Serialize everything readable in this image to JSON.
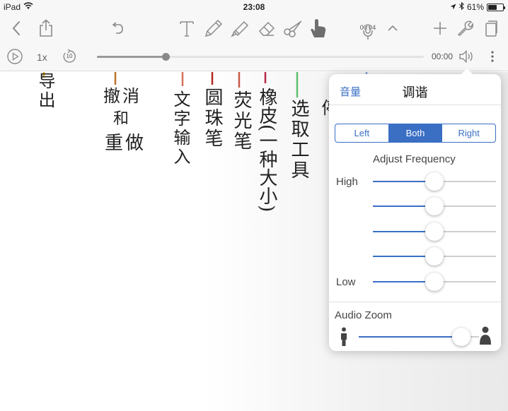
{
  "status": {
    "device": "iPad",
    "time": "23:08",
    "battery": "61%",
    "battery_level": 0.61
  },
  "toolbar": {
    "recording_time": "00:04"
  },
  "playback": {
    "speed": "1x",
    "skip_back": "10",
    "elapsed": "00:00",
    "progress": 0.21
  },
  "canvas": {
    "notes": [
      {
        "text": "导出",
        "color": "#e0b02c"
      },
      {
        "text": "撤消",
        "color": "#b8732a"
      },
      {
        "text": "和",
        "color": "#b8732a"
      },
      {
        "text": "重做",
        "color": "#b8732a"
      },
      {
        "text": "文字输入",
        "color": "#d4705c"
      },
      {
        "text": "圆珠笔",
        "color": "#b02820"
      },
      {
        "text": "荧光笔",
        "color": "#c95a48"
      },
      {
        "text": "橡皮(一种大小)",
        "color": "#b8284a"
      },
      {
        "text": "选取工具",
        "color": "#5cbf6a"
      },
      {
        "text": "停",
        "color": "#7aa0d0"
      }
    ]
  },
  "popover": {
    "back_label": "音量",
    "title": "调谐",
    "channels": [
      "Left",
      "Both",
      "Right"
    ],
    "selected_channel": "Both",
    "adjust_label": "Adjust Frequency",
    "high_label": "High",
    "low_label": "Low",
    "frequency_levels": [
      0.5,
      0.5,
      0.5,
      0.5,
      0.5
    ],
    "zoom_label": "Audio Zoom",
    "zoom_level": 0.92
  },
  "colors": {
    "accent": "#3a6fc4",
    "toolbar_icon": "#8a8a8a",
    "active_tool": "#6e6e6e"
  }
}
